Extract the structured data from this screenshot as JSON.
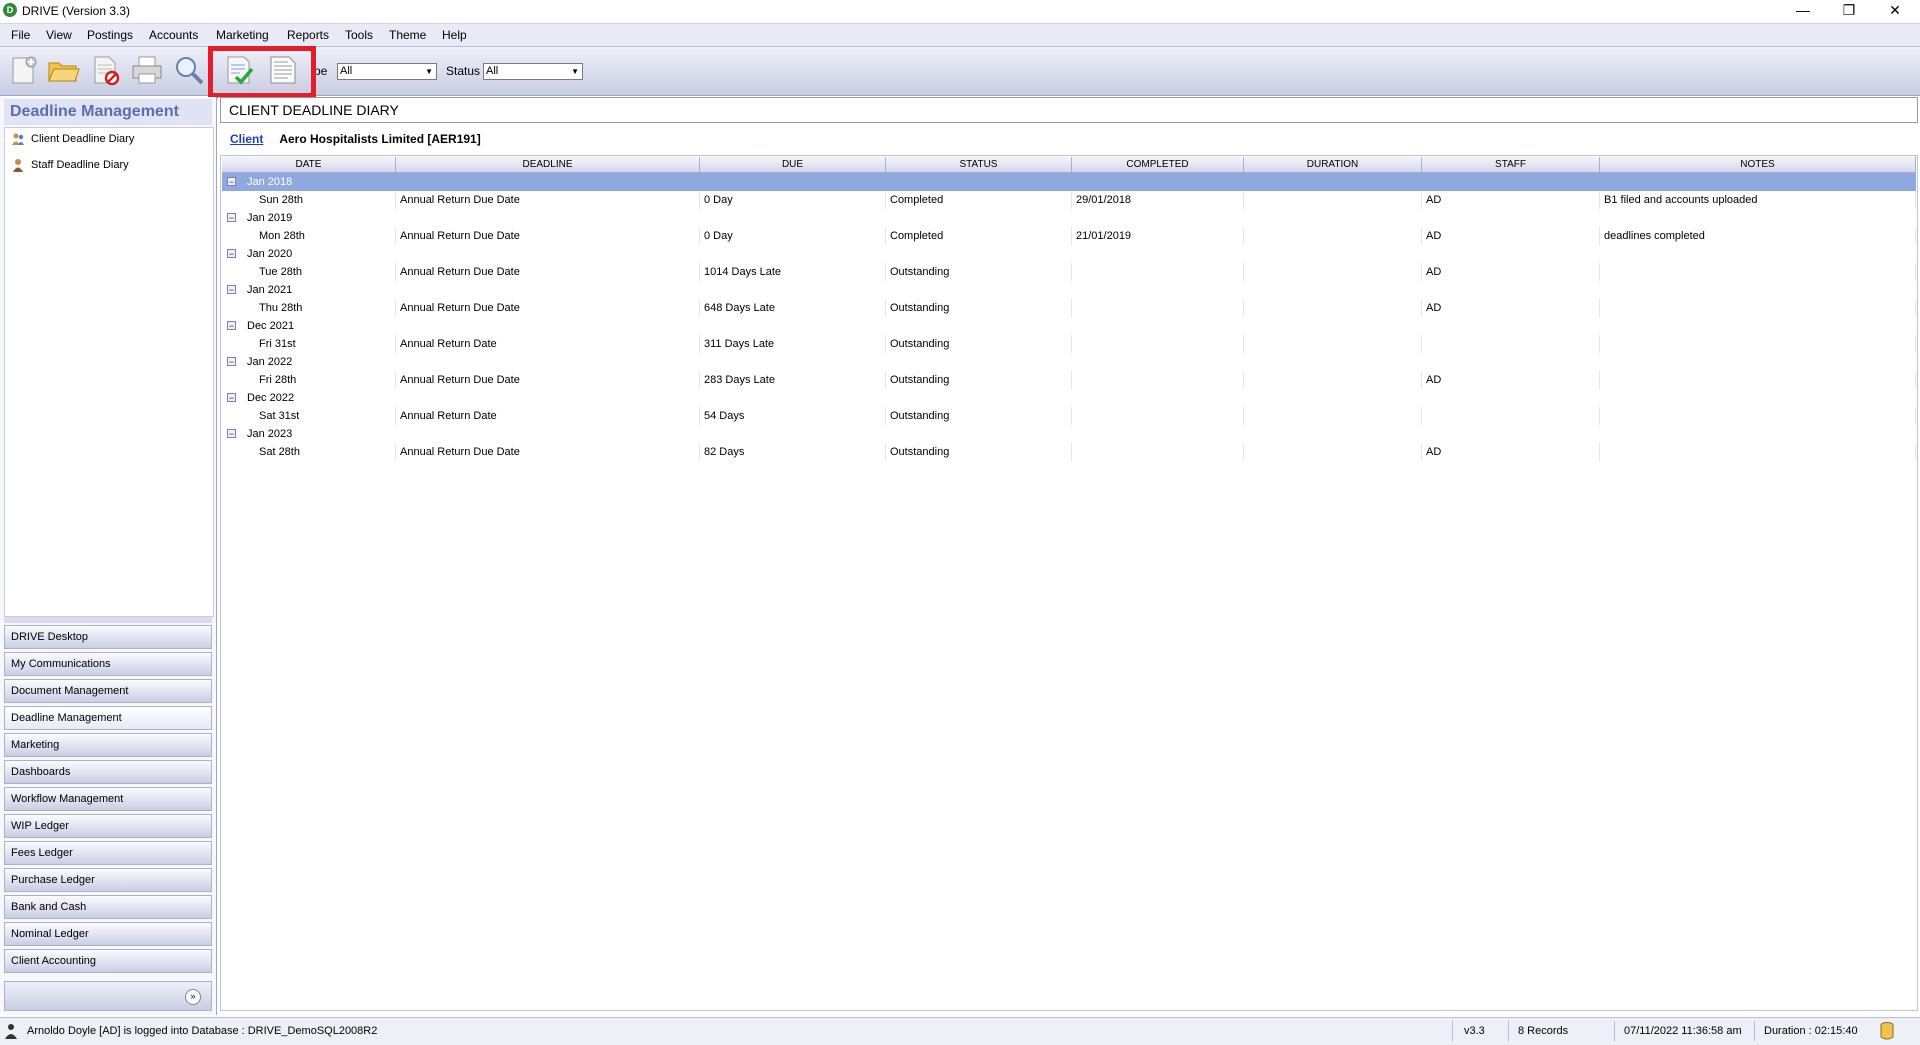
{
  "window": {
    "title": "DRIVE (Version 3.3)",
    "minimize": "—",
    "restore": "❐",
    "close": "✕"
  },
  "menu": [
    "File",
    "View",
    "Postings",
    "Accounts",
    "Marketing",
    "Reports",
    "Tools",
    "Theme",
    "Help"
  ],
  "toolbar": {
    "icons": [
      "new-document-icon",
      "open-folder-icon",
      "delete-document-icon",
      "print-icon",
      "search-icon",
      "mark-complete-icon",
      "notes-icon"
    ],
    "type_label": "pe",
    "type_value": "All",
    "status_label": "Status",
    "status_value": "All",
    "highlight_color": "#e31e2a"
  },
  "nav": {
    "header": "Deadline Management",
    "tree": [
      {
        "label": "Client Deadline Diary",
        "icon": "people-icon"
      },
      {
        "label": "Staff Deadline Diary",
        "icon": "person-icon"
      }
    ],
    "buttons": [
      {
        "label": "DRIVE Desktop",
        "active": false
      },
      {
        "label": "My Communications",
        "active": false
      },
      {
        "label": "Document Management",
        "active": false
      },
      {
        "label": "Deadline Management",
        "active": true
      },
      {
        "label": "Marketing",
        "active": false
      },
      {
        "label": "Dashboards",
        "active": false
      },
      {
        "label": "Workflow Management",
        "active": false
      },
      {
        "label": "WIP Ledger",
        "active": false
      },
      {
        "label": "Fees Ledger",
        "active": false
      },
      {
        "label": "Purchase Ledger",
        "active": false
      },
      {
        "label": "Bank and Cash",
        "active": false
      },
      {
        "label": "Nominal Ledger",
        "active": false
      },
      {
        "label": "Client Accounting",
        "active": false
      }
    ],
    "expand": "»"
  },
  "main": {
    "page_title": "CLIENT DEADLINE DIARY",
    "client_label": "Client",
    "client_name": "Aero Hospitalists Limited [AER191]"
  },
  "grid": {
    "columns": [
      "DATE",
      "DEADLINE",
      "DUE",
      "STATUS",
      "COMPLETED",
      "DURATION",
      "STAFF",
      "NOTES"
    ],
    "rows": [
      {
        "group": "Jan 2018",
        "selected": true
      },
      {
        "cells": [
          "Sun 28th",
          "Annual Return Due Date",
          "0 Day",
          "Completed",
          "29/01/2018",
          "",
          "AD",
          "B1 filed and accounts uploaded"
        ]
      },
      {
        "group": "Jan 2019"
      },
      {
        "cells": [
          "Mon 28th",
          "Annual Return Due Date",
          "0 Day",
          "Completed",
          "21/01/2019",
          "",
          "AD",
          "deadlines completed"
        ]
      },
      {
        "group": "Jan 2020"
      },
      {
        "cells": [
          "Tue 28th",
          "Annual Return Due Date",
          "1014 Days Late",
          "Outstanding",
          "",
          "",
          "AD",
          ""
        ]
      },
      {
        "group": "Jan 2021"
      },
      {
        "cells": [
          "Thu 28th",
          "Annual Return Due Date",
          "648 Days Late",
          "Outstanding",
          "",
          "",
          "AD",
          ""
        ]
      },
      {
        "group": "Dec 2021"
      },
      {
        "cells": [
          "Fri 31st",
          "Annual Return Date",
          "311 Days Late",
          "Outstanding",
          "",
          "",
          "",
          ""
        ]
      },
      {
        "group": "Jan 2022"
      },
      {
        "cells": [
          "Fri 28th",
          "Annual Return Due Date",
          "283 Days Late",
          "Outstanding",
          "",
          "",
          "AD",
          ""
        ]
      },
      {
        "group": "Dec 2022"
      },
      {
        "cells": [
          "Sat 31st",
          "Annual Return Date",
          "54 Days",
          "Outstanding",
          "",
          "",
          "",
          ""
        ]
      },
      {
        "group": "Jan 2023"
      },
      {
        "cells": [
          "Sat 28th",
          "Annual Return Due Date",
          "82 Days",
          "Outstanding",
          "",
          "",
          "AD",
          ""
        ]
      }
    ]
  },
  "status": {
    "user": "Arnoldo Doyle [AD] is logged into Database : DRIVE_DemoSQL2008R2",
    "version": "v3.3",
    "records": "8 Records",
    "datetime": "07/11/2022 11:36:58 am",
    "duration": "Duration : 02:15:40"
  }
}
